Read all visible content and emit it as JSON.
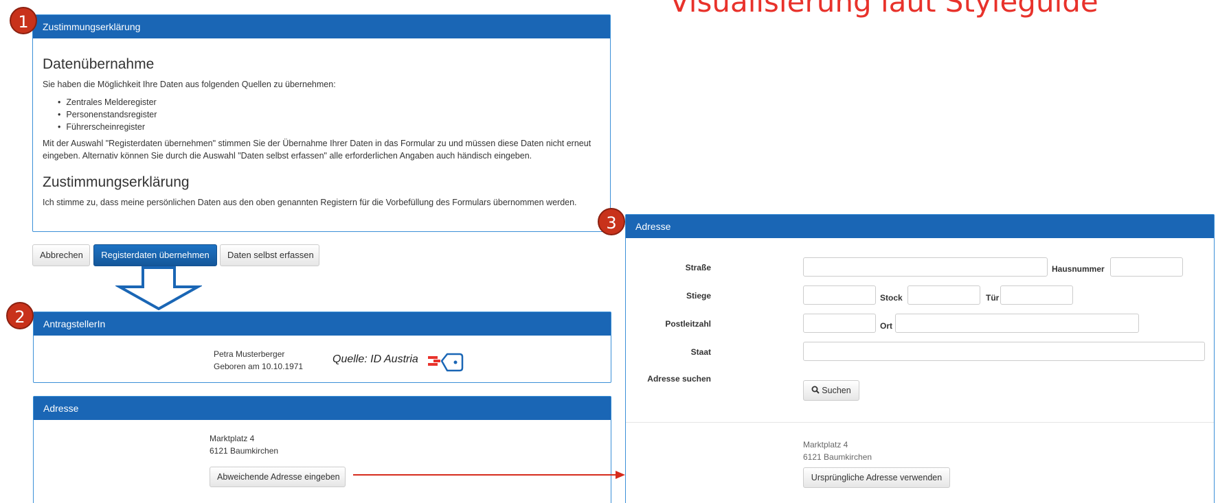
{
  "headline": "Visualisierung laut Styleguide",
  "badges": [
    "1",
    "2",
    "3"
  ],
  "consent_panel": {
    "header": "Zustimmungserklärung",
    "section1_title": "Datenübernahme",
    "intro": "Sie haben die Möglichkeit Ihre Daten aus folgenden Quellen zu übernehmen:",
    "sources": [
      "Zentrales Melderegister",
      "Personenstandsregister",
      "Führerscheinregister"
    ],
    "explanation": "Mit der Auswahl \"Registerdaten übernehmen\" stimmen Sie der Übernahme Ihrer Daten in das Formular zu und müssen diese Daten nicht erneut eingeben. Alternativ können Sie durch die Auswahl \"Daten selbst erfassen\" alle erforderlichen Angaben auch händisch eingeben.",
    "section2_title": "Zustimmungserklärung",
    "consent_text": "Ich stimme zu, dass meine persönlichen Daten aus den oben genannten Registern für die Vorbefüllung des Formulars übernommen werden."
  },
  "actions": {
    "cancel": "Abbrechen",
    "take_over": "Registerdaten übernehmen",
    "self_enter": "Daten selbst erfassen"
  },
  "applicant_panel": {
    "header": "AntragstellerIn",
    "name": "Petra Musterberger",
    "birth": "Geboren am 10.10.1971",
    "source": "Quelle: ID Austria"
  },
  "address_panel": {
    "header": "Adresse",
    "street": "Marktplatz 4",
    "city": "6121 Baumkirchen",
    "button": "Abweichende Adresse eingeben"
  },
  "address_form": {
    "header": "Adresse",
    "labels": {
      "strasse": "Straße",
      "hausnummer": "Hausnummer",
      "stiege": "Stiege",
      "stock": "Stock",
      "tuer": "Tür",
      "plz": "Postleitzahl",
      "ort": "Ort",
      "staat": "Staat",
      "suchen_label": "Adresse suchen"
    },
    "search_button": "Suchen",
    "current_street": "Marktplatz 4",
    "current_city": "6121 Baumkirchen",
    "restore_button": "Ursprüngliche Adresse verwenden"
  },
  "colors": {
    "accent": "#1a66b5",
    "badge": "#c8321b",
    "headline": "#e8322b",
    "arrow": "#d62b1c"
  }
}
